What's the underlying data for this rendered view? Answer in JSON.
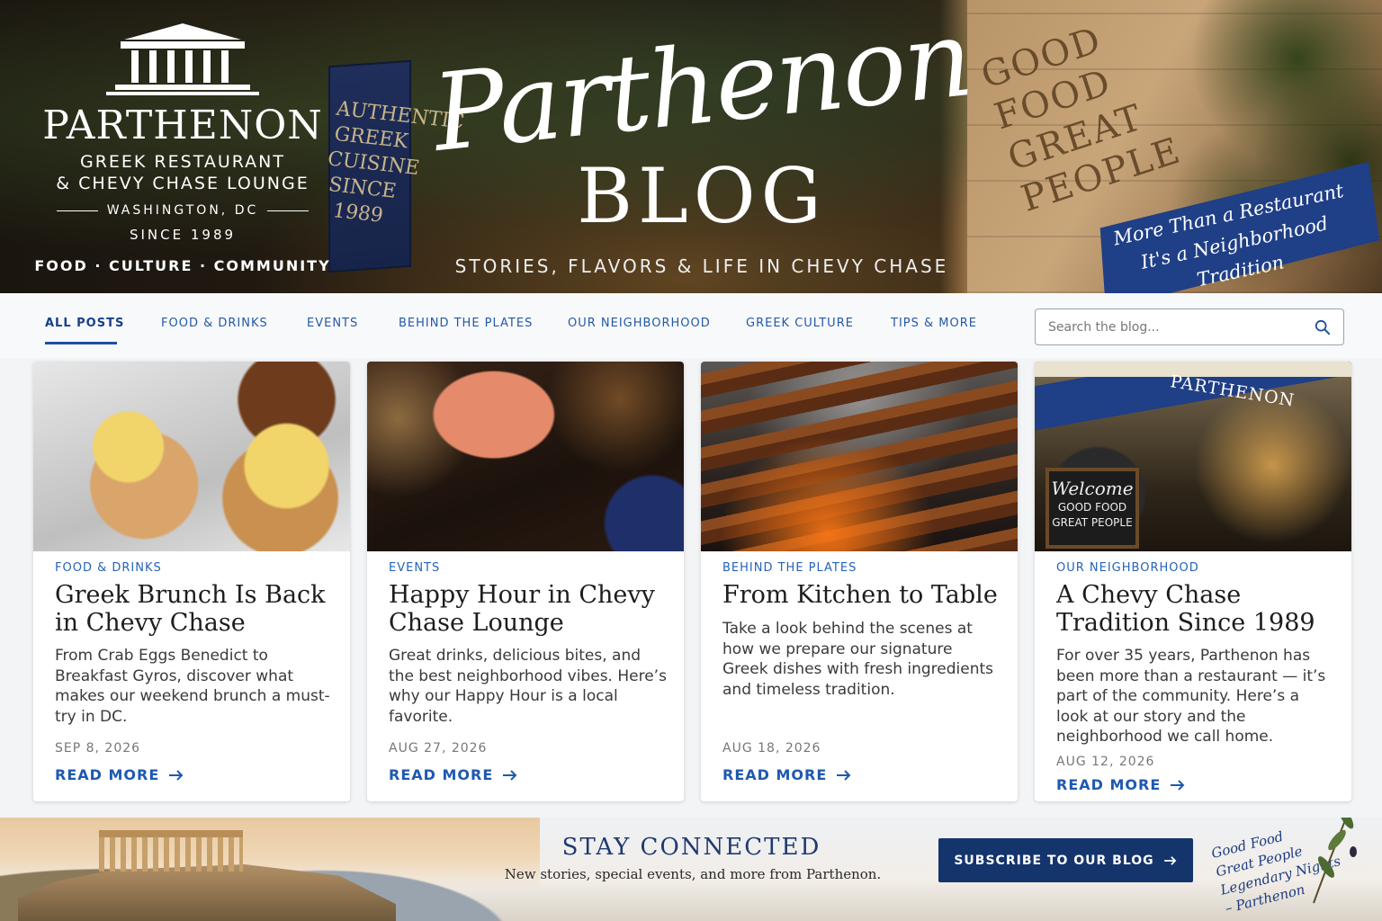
{
  "hero": {
    "logo": {
      "name": "PARTHENON",
      "subtitle_line1": "GREEK RESTAURANT",
      "subtitle_line2": "& CHEVY CHASE LOUNGE",
      "city": "WASHINGTON, DC",
      "since": "SINCE 1989",
      "tags": "FOOD · CULTURE · COMMUNITY"
    },
    "title_script": "Parthenon",
    "title_main": "BLOG",
    "tagline": "STORIES, FLAVORS & LIFE IN CHEVY CHASE",
    "banner_side_text": "AUTHENTIC\nGREEK\nCUISINE\nSINCE 1989",
    "carved_text": "GOOD\nFOOD\nGREAT\nPEOPLE",
    "ribbon_line1": "More Than a Restaurant",
    "ribbon_line2": "It's a Neighborhood Tradition"
  },
  "nav": {
    "tabs": [
      {
        "label": "ALL POSTS",
        "active": true
      },
      {
        "label": "FOOD & DRINKS"
      },
      {
        "label": "EVENTS"
      },
      {
        "label": "BEHIND THE PLATES"
      },
      {
        "label": "OUR NEIGHBORHOOD"
      },
      {
        "label": "GREEK CULTURE"
      },
      {
        "label": "TIPS & MORE"
      }
    ],
    "search": {
      "placeholder": "Search the blog...",
      "icon": "search-icon"
    }
  },
  "posts": [
    {
      "category": "FOOD & DRINKS",
      "title": "Greek Brunch Is Back in Chevy Chase",
      "description": "From Crab Eggs Benedict to Breakfast Gyros, discover what makes our weekend brunch a must-try in DC.",
      "date": "SEP 8, 2026",
      "read_more": "READ MORE"
    },
    {
      "category": "EVENTS",
      "title": "Happy Hour in Chevy Chase Lounge",
      "description": "Great drinks, delicious bites, and the best neighborhood vibes. Here’s why our Happy Hour is a local favorite.",
      "date": "AUG 27, 2026",
      "read_more": "READ MORE"
    },
    {
      "category": "BEHIND THE PLATES",
      "title": "From Kitchen to Table",
      "description": "Take a look behind the scenes at how we prepare our signature Greek dishes with fresh ingredients and timeless tradition.",
      "date": "AUG 18, 2026",
      "read_more": "READ MORE"
    },
    {
      "category": "OUR NEIGHBORHOOD",
      "title": "A Chevy Chase Tradition Since 1989",
      "description": "For over 35 years, Parthenon has been more than a restaurant — it’s part of the community. Here’s a look at our story and the neighborhood we call home.",
      "date": "AUG 12, 2026",
      "read_more": "READ MORE",
      "awning_text": "PARTHENON",
      "board_welcome": "Welcome",
      "board_text": "GOOD FOOD\nGREAT PEOPLE"
    }
  ],
  "footer": {
    "title": "STAY CONNECTED",
    "subtitle": "New stories, special events, and more from Parthenon.",
    "subscribe_label": "SUBSCRIBE TO OUR BLOG",
    "signoff": "Good Food\nGreat People\nLegendary Nights\n– Parthenon"
  },
  "colors": {
    "accent": "#1e59b0",
    "navy": "#14346c",
    "ribbon": "#1f3f86"
  }
}
